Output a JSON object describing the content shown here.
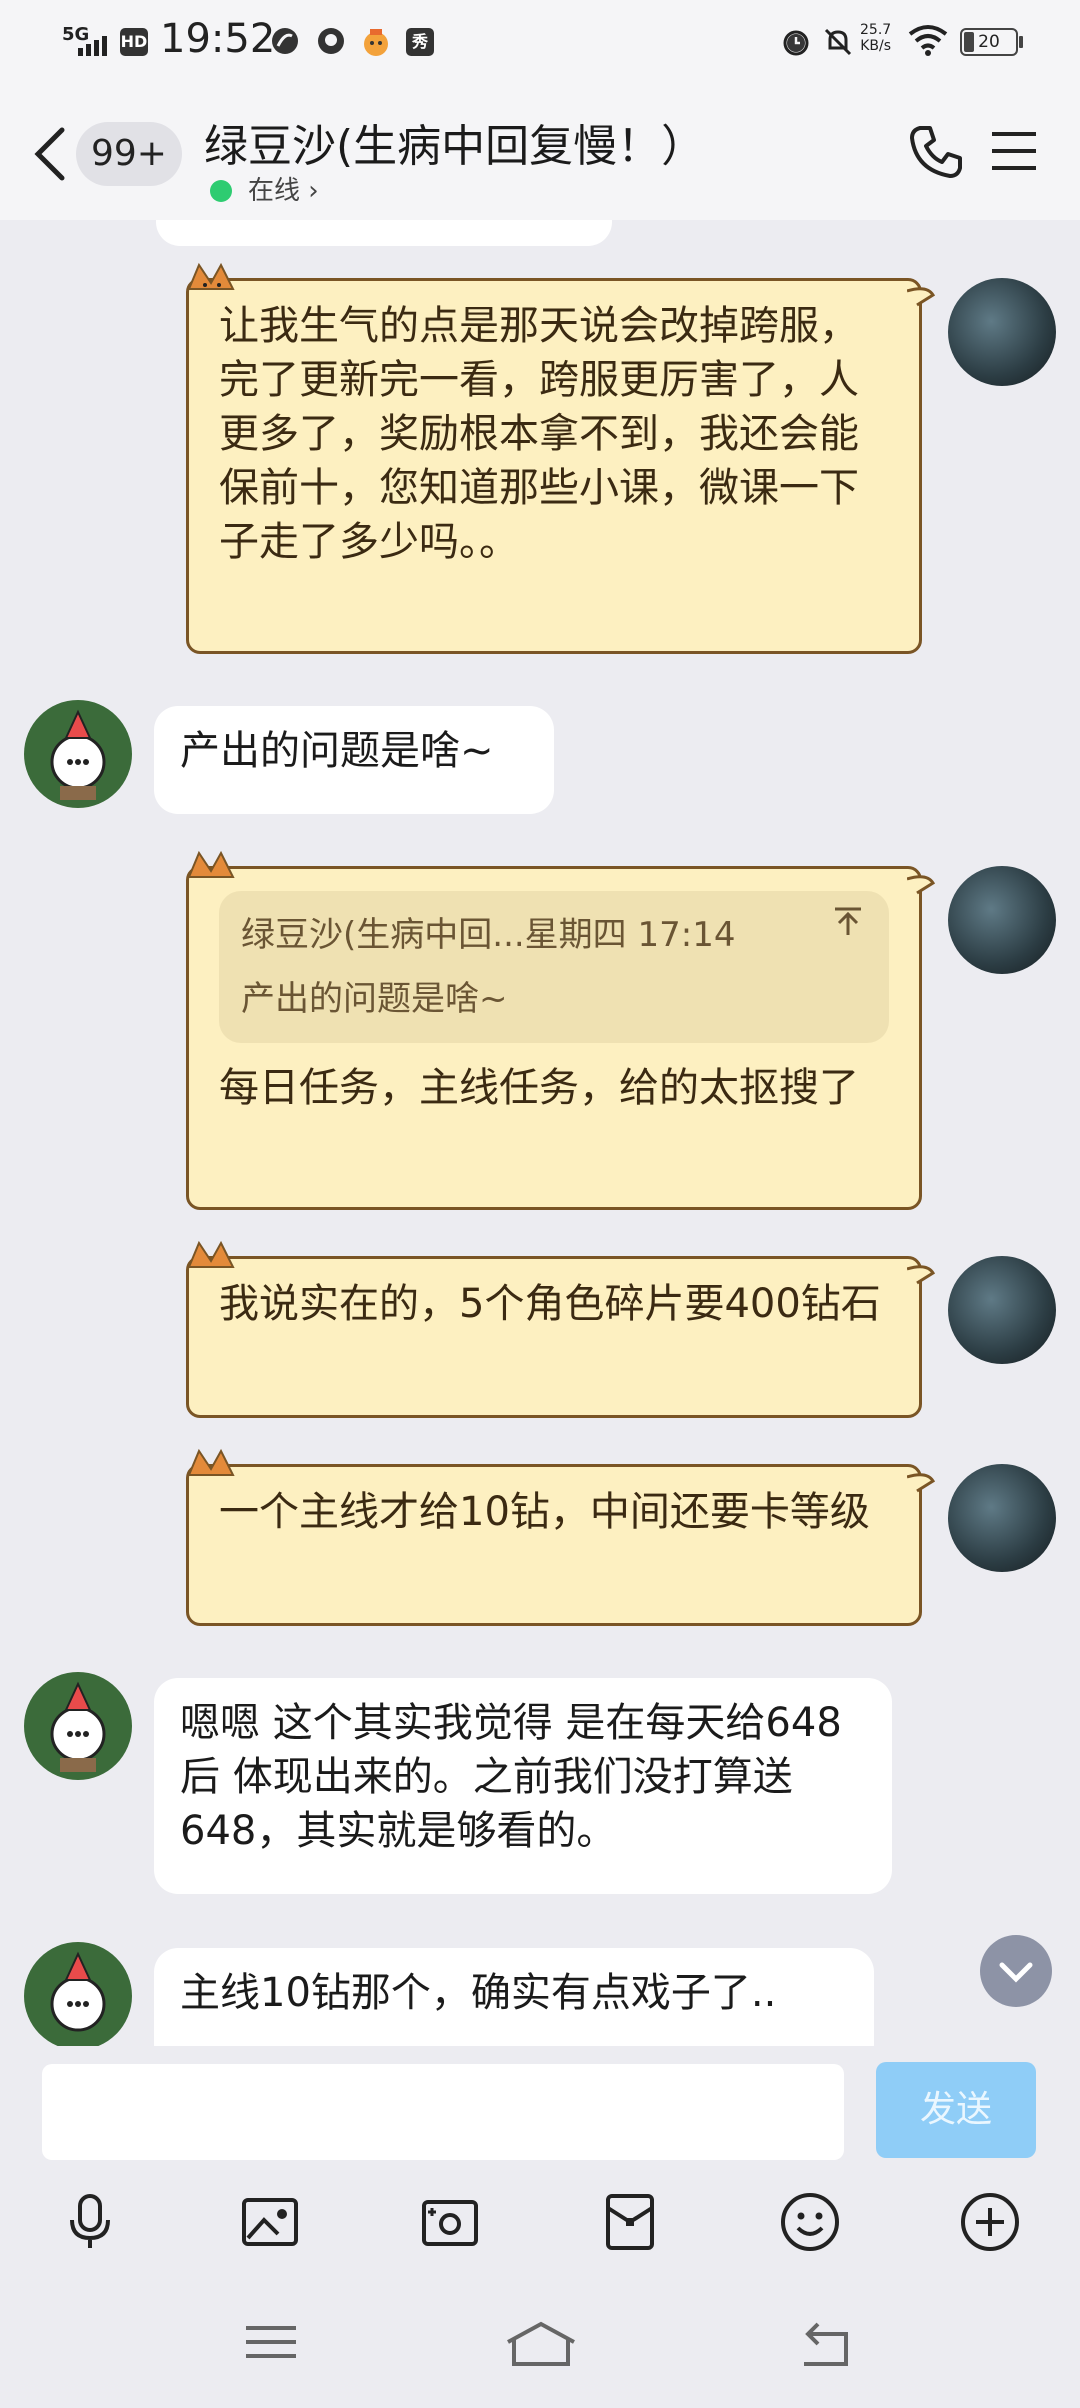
{
  "status_bar": {
    "network": "5G",
    "hd": "HD",
    "time": "19:52",
    "app_badge": "秀",
    "speed_value": "25.7",
    "speed_unit": "KB/s",
    "battery": "20"
  },
  "header": {
    "unread_count": "99+",
    "contact_name": "绿豆沙(生病中回复慢！）",
    "status": "在线 ›",
    "icons": [
      "back-chevron-icon",
      "phone-icon",
      "menu-icon"
    ]
  },
  "messages": [
    {
      "from": "me",
      "text": "让我生气的点是那天说会改掉跨服，完了更新完一看，跨服更厉害了，人更多了，奖励根本拿不到，我还会能保前十，您知道那些小课，微课一下子走了多少吗。。"
    },
    {
      "from": "other",
      "text": "产出的问题是啥~"
    },
    {
      "from": "me",
      "quote_header": "绿豆沙(生病中回...星期四 17:14",
      "quote_text": "产出的问题是啥~",
      "text": "每日任务，主线任务，给的太抠搜了"
    },
    {
      "from": "me",
      "text": "我说实在的，5个角色碎片要400钻石"
    },
    {
      "from": "me",
      "text": "一个主线才给10钻，中间还要卡等级"
    },
    {
      "from": "other",
      "text": "嗯嗯 这个其实我觉得 是在每天给648后 体现出来的。之前我们没打算送648，其实就是够看的。"
    },
    {
      "from": "other",
      "text": "主线10钻那个，确实有点戏子了.."
    }
  ],
  "input": {
    "placeholder": "",
    "send_label": "发送"
  },
  "toolbar": [
    "microphone-icon",
    "image-icon",
    "camera-icon",
    "red-packet-icon",
    "emoji-icon",
    "plus-icon"
  ],
  "colors": {
    "my_bubble": "#fdf0c1",
    "my_bubble_border": "#7a5525",
    "online": "#2ecc71",
    "send_button": "#8fcdf7"
  }
}
